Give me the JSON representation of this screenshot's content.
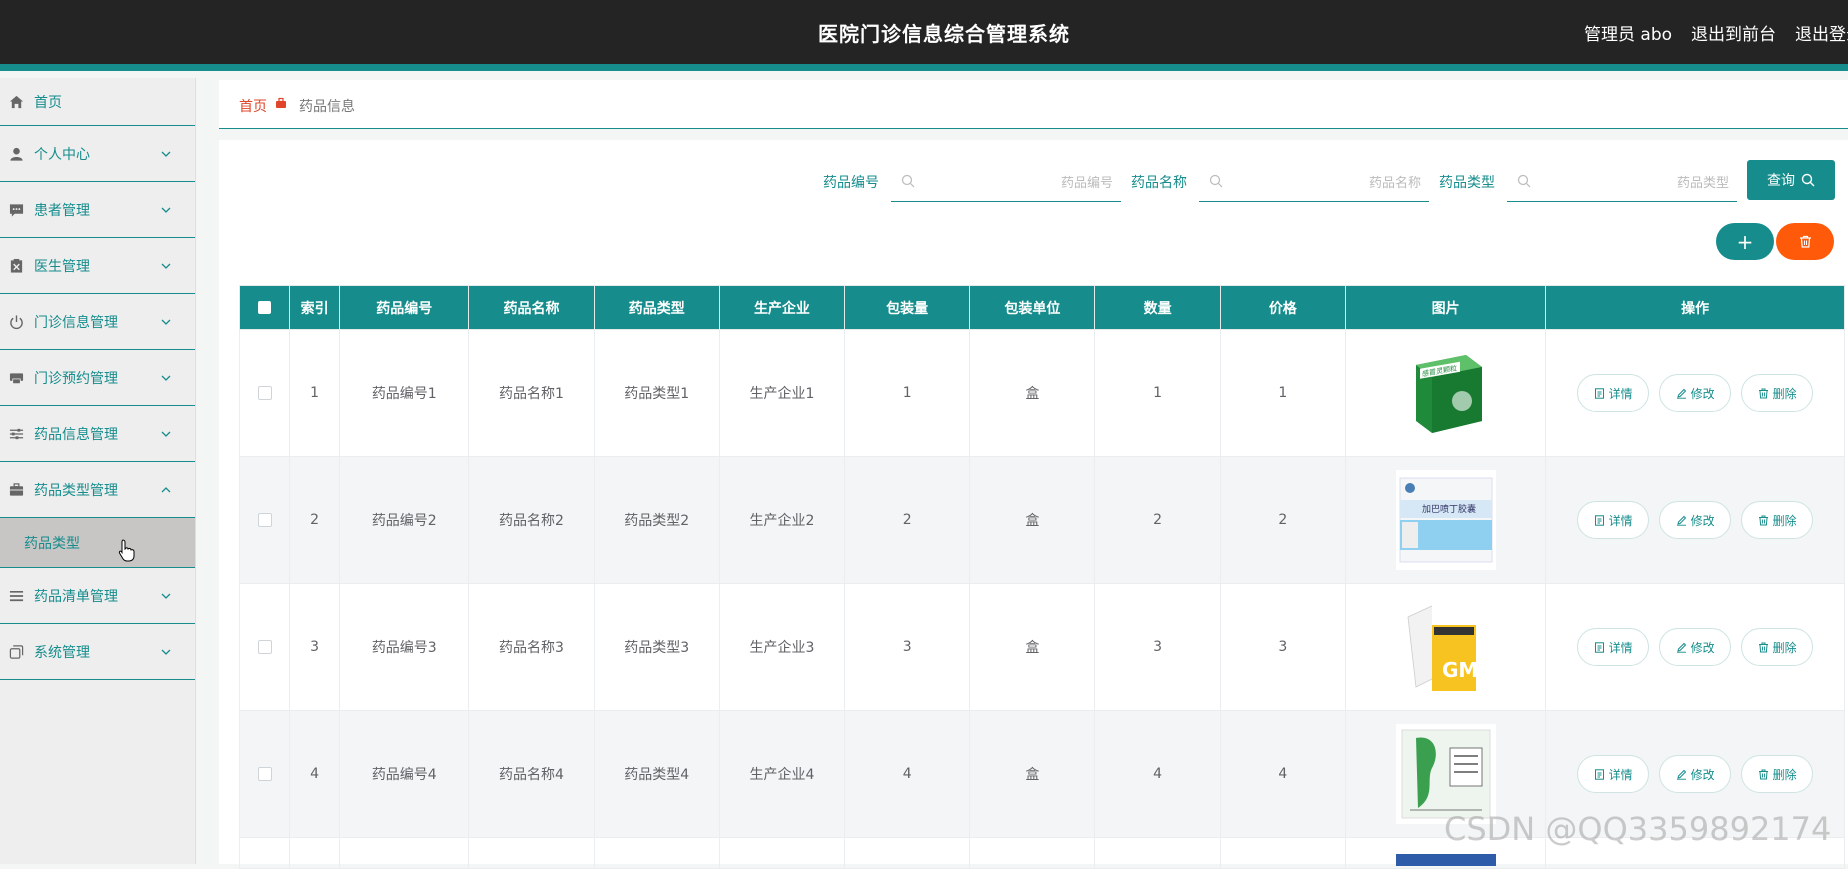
{
  "header": {
    "title": "医院门诊信息综合管理系统",
    "user": "管理员 abo",
    "front_link": "退出到前台",
    "logout_link": "退出登录"
  },
  "sidebar": {
    "items": [
      {
        "label": "首页",
        "icon": "home-icon"
      },
      {
        "label": "个人中心",
        "icon": "user-icon"
      },
      {
        "label": "患者管理",
        "icon": "chat-icon"
      },
      {
        "label": "医生管理",
        "icon": "clipboard-icon"
      },
      {
        "label": "门诊信息管理",
        "icon": "power-icon"
      },
      {
        "label": "门诊预约管理",
        "icon": "printer-icon"
      },
      {
        "label": "药品信息管理",
        "icon": "sliders-icon"
      },
      {
        "label": "药品类型管理",
        "icon": "briefcase-icon"
      },
      {
        "label": "药品清单管理",
        "icon": "list-icon"
      },
      {
        "label": "系统管理",
        "icon": "copy-icon"
      }
    ],
    "sub_item": "药品类型"
  },
  "breadcrumb": {
    "home": "首页",
    "current": "药品信息"
  },
  "search": {
    "code_label": "药品编号",
    "code_placeholder": "药品编号",
    "name_label": "药品名称",
    "name_placeholder": "药品名称",
    "type_label": "药品类型",
    "type_placeholder": "药品类型",
    "query_button": "查询"
  },
  "actions": {
    "add_symbol": "+"
  },
  "table": {
    "headers": [
      "索引",
      "药品编号",
      "药品名称",
      "药品类型",
      "生产企业",
      "包装量",
      "包装单位",
      "数量",
      "价格",
      "图片",
      "操作"
    ],
    "rows": [
      {
        "index": "1",
        "code": "药品编号1",
        "name": "药品名称1",
        "type": "药品类型1",
        "maker": "生产企业1",
        "pack": "1",
        "unit": "盒",
        "qty": "1",
        "price": "1"
      },
      {
        "index": "2",
        "code": "药品编号2",
        "name": "药品名称2",
        "type": "药品类型2",
        "maker": "生产企业2",
        "pack": "2",
        "unit": "盒",
        "qty": "2",
        "price": "2"
      },
      {
        "index": "3",
        "code": "药品编号3",
        "name": "药品名称3",
        "type": "药品类型3",
        "maker": "生产企业3",
        "pack": "3",
        "unit": "盒",
        "qty": "3",
        "price": "3"
      },
      {
        "index": "4",
        "code": "药品编号4",
        "name": "药品名称4",
        "type": "药品类型4",
        "maker": "生产企业4",
        "pack": "4",
        "unit": "盒",
        "qty": "4",
        "price": "4"
      }
    ],
    "op_detail": "详情",
    "op_edit": "修改",
    "op_delete": "删除"
  },
  "photos": {
    "pill_box_1_text": "感冒灵颗粒",
    "pill_box_2_text": "加巴喷丁胶囊"
  },
  "watermark": "CSDN @QQ3359892174",
  "colors": {
    "accent": "#168c8c",
    "danger": "#ff5a0a",
    "header_bg": "#242424",
    "breadcrumb_home": "#e0452b"
  }
}
